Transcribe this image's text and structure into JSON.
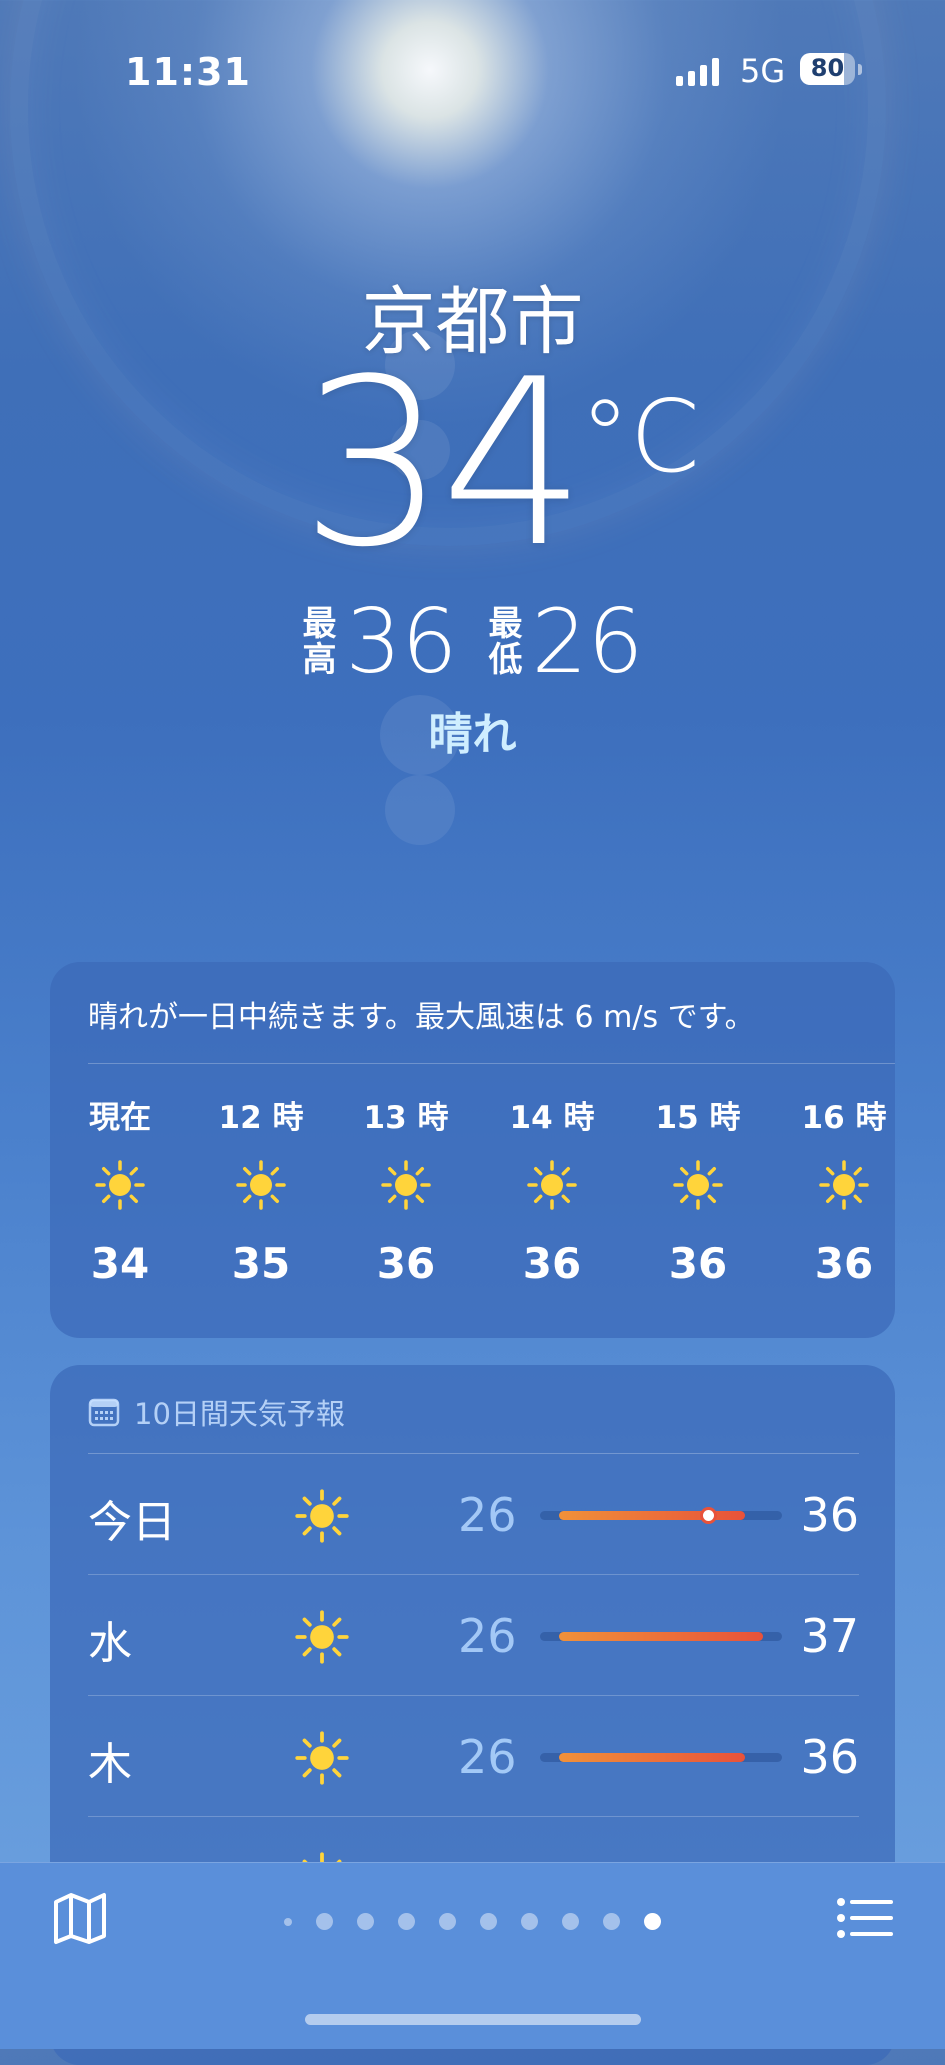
{
  "status_bar": {
    "time": "11:31",
    "network": "5G",
    "battery": "80"
  },
  "location": {
    "city": "京都市",
    "temperature": "34",
    "unit": "°C",
    "high_label": "最高",
    "high": "36",
    "low_label": "最低",
    "low": "26",
    "condition": "晴れ"
  },
  "hourly": {
    "summary": "晴れが一日中続きます。最大風速は 6 m/s です。",
    "items": [
      {
        "label": "現在",
        "icon": "sun-icon",
        "temp": "34"
      },
      {
        "label": "12 時",
        "icon": "sun-icon",
        "temp": "35"
      },
      {
        "label": "13 時",
        "icon": "sun-icon",
        "temp": "36"
      },
      {
        "label": "14 時",
        "icon": "sun-icon",
        "temp": "36"
      },
      {
        "label": "15 時",
        "icon": "sun-icon",
        "temp": "36"
      },
      {
        "label": "16 時",
        "icon": "sun-icon",
        "temp": "36"
      }
    ]
  },
  "daily": {
    "header": "10日間天気予報",
    "header_icon": "calendar-icon",
    "range": {
      "min": 25,
      "max": 38
    },
    "items": [
      {
        "day": "今日",
        "icon": "sun-icon",
        "low": "26",
        "high": "36",
        "low_value": 26,
        "high_value": 36,
        "current": 34
      },
      {
        "day": "水",
        "icon": "sun-icon",
        "low": "26",
        "high": "37",
        "low_value": 26,
        "high_value": 37
      },
      {
        "day": "木",
        "icon": "sun-icon",
        "low": "26",
        "high": "36",
        "low_value": 26,
        "high_value": 36
      }
    ]
  },
  "bottom_bar": {
    "map_icon": "map-icon",
    "list_icon": "list-icon",
    "page_count": 10,
    "active_page": 10
  },
  "colors": {
    "accent_condition": "#cfeeff",
    "bar_start": "#f0913a",
    "bar_end": "#e8523a"
  }
}
